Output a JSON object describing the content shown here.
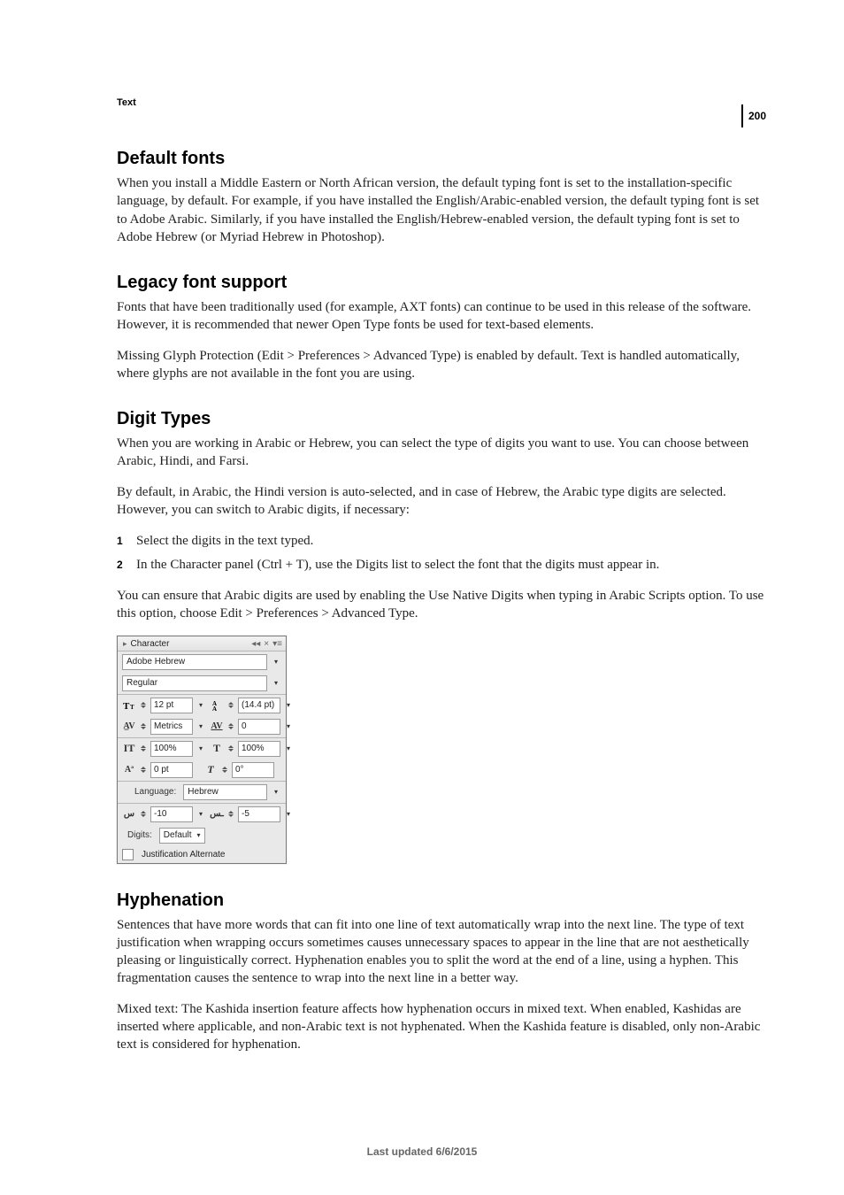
{
  "page_number": "200",
  "section_tag": "Text",
  "footer": "Last updated 6/6/2015",
  "sections": {
    "default_fonts": {
      "heading": "Default fonts",
      "p1": "When you install a Middle Eastern or North African version, the default typing font is set to the installation-specific language, by default. For example, if you have installed the English/Arabic-enabled version, the default typing font is set to Adobe Arabic. Similarly, if you have installed the English/Hebrew-enabled version, the default typing font is set to Adobe Hebrew (or Myriad Hebrew in Photoshop)."
    },
    "legacy": {
      "heading": "Legacy font support",
      "p1": "Fonts that have been traditionally used (for example, AXT fonts) can continue to be used in this release of the software. However, it is recommended that newer Open Type fonts be used for text-based elements.",
      "p2": "Missing Glyph Protection (Edit > Preferences > Advanced Type) is enabled by default. Text is handled automatically, where glyphs are not available in the font you are using."
    },
    "digit": {
      "heading": "Digit Types",
      "p1": "When you are working in Arabic or Hebrew, you can select the type of digits you want to use. You can choose between Arabic, Hindi, and Farsi.",
      "p2": "By default, in Arabic, the Hindi version is auto-selected, and in case of Hebrew, the Arabic type digits are selected. However, you can switch to Arabic digits, if necessary:",
      "step1": "Select the digits in the text typed.",
      "step2": "In the Character panel (Ctrl + T), use the Digits list to select the font that the digits must appear in.",
      "p3": "You can ensure that Arabic digits are used by enabling the Use Native Digits when typing in Arabic Scripts option. To use this option, choose Edit > Preferences > Advanced Type."
    },
    "hyphen": {
      "heading": "Hyphenation",
      "p1": "Sentences that have more words that can fit into one line of text automatically wrap into the next line. The type of text justification when wrapping occurs sometimes causes unnecessary spaces to appear in the line that are not aesthetically pleasing or linguistically correct. Hyphenation enables you to split the word at the end of a line, using a hyphen. This fragmentation causes the sentence to wrap into the next line in a better way.",
      "p2": "Mixed text: The Kashida insertion feature affects how hyphenation occurs in mixed text. When enabled, Kashidas are inserted where applicable, and non-Arabic text is not hyphenated. When the Kashida feature is disabled, only non-Arabic text is considered for hyphenation."
    }
  },
  "panel": {
    "title": "Character",
    "font_family": "Adobe Hebrew",
    "font_style": "Regular",
    "font_size": "12 pt",
    "leading": "(14.4 pt)",
    "kerning": "Metrics",
    "tracking": "0",
    "vscale": "100%",
    "hscale": "100%",
    "baseline": "0 pt",
    "skew": "0°",
    "language_label": "Language:",
    "language": "Hebrew",
    "discretionary1": "-10",
    "discretionary2": "-5",
    "digits_label": "Digits:",
    "digits_value": "Default",
    "justification_alt": "Justification Alternate"
  }
}
